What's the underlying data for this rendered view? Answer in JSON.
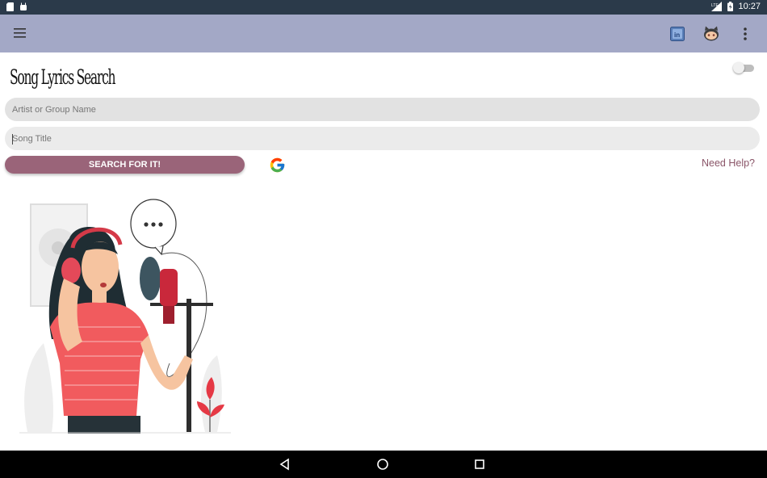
{
  "status_bar": {
    "time": "10:27",
    "network_label": "LTE",
    "icons": [
      "sd-card-icon",
      "android-icon",
      "signal-icon",
      "battery-icon"
    ]
  },
  "app_bar": {
    "color": "#a3a8c6",
    "actions": [
      "linkedin-icon",
      "github-icon",
      "more-vert-icon"
    ]
  },
  "main": {
    "title": "Song Lyrics Search",
    "artist_placeholder": "Artist or Group Name",
    "song_placeholder": "Song Title",
    "search_label": "SEARCH FOR IT!",
    "search_color": "#9a6479",
    "help_label": "Need Help?",
    "dark_mode_toggle": false
  },
  "nav_bar": {
    "buttons": [
      "back-icon",
      "home-icon",
      "recents-icon"
    ]
  }
}
